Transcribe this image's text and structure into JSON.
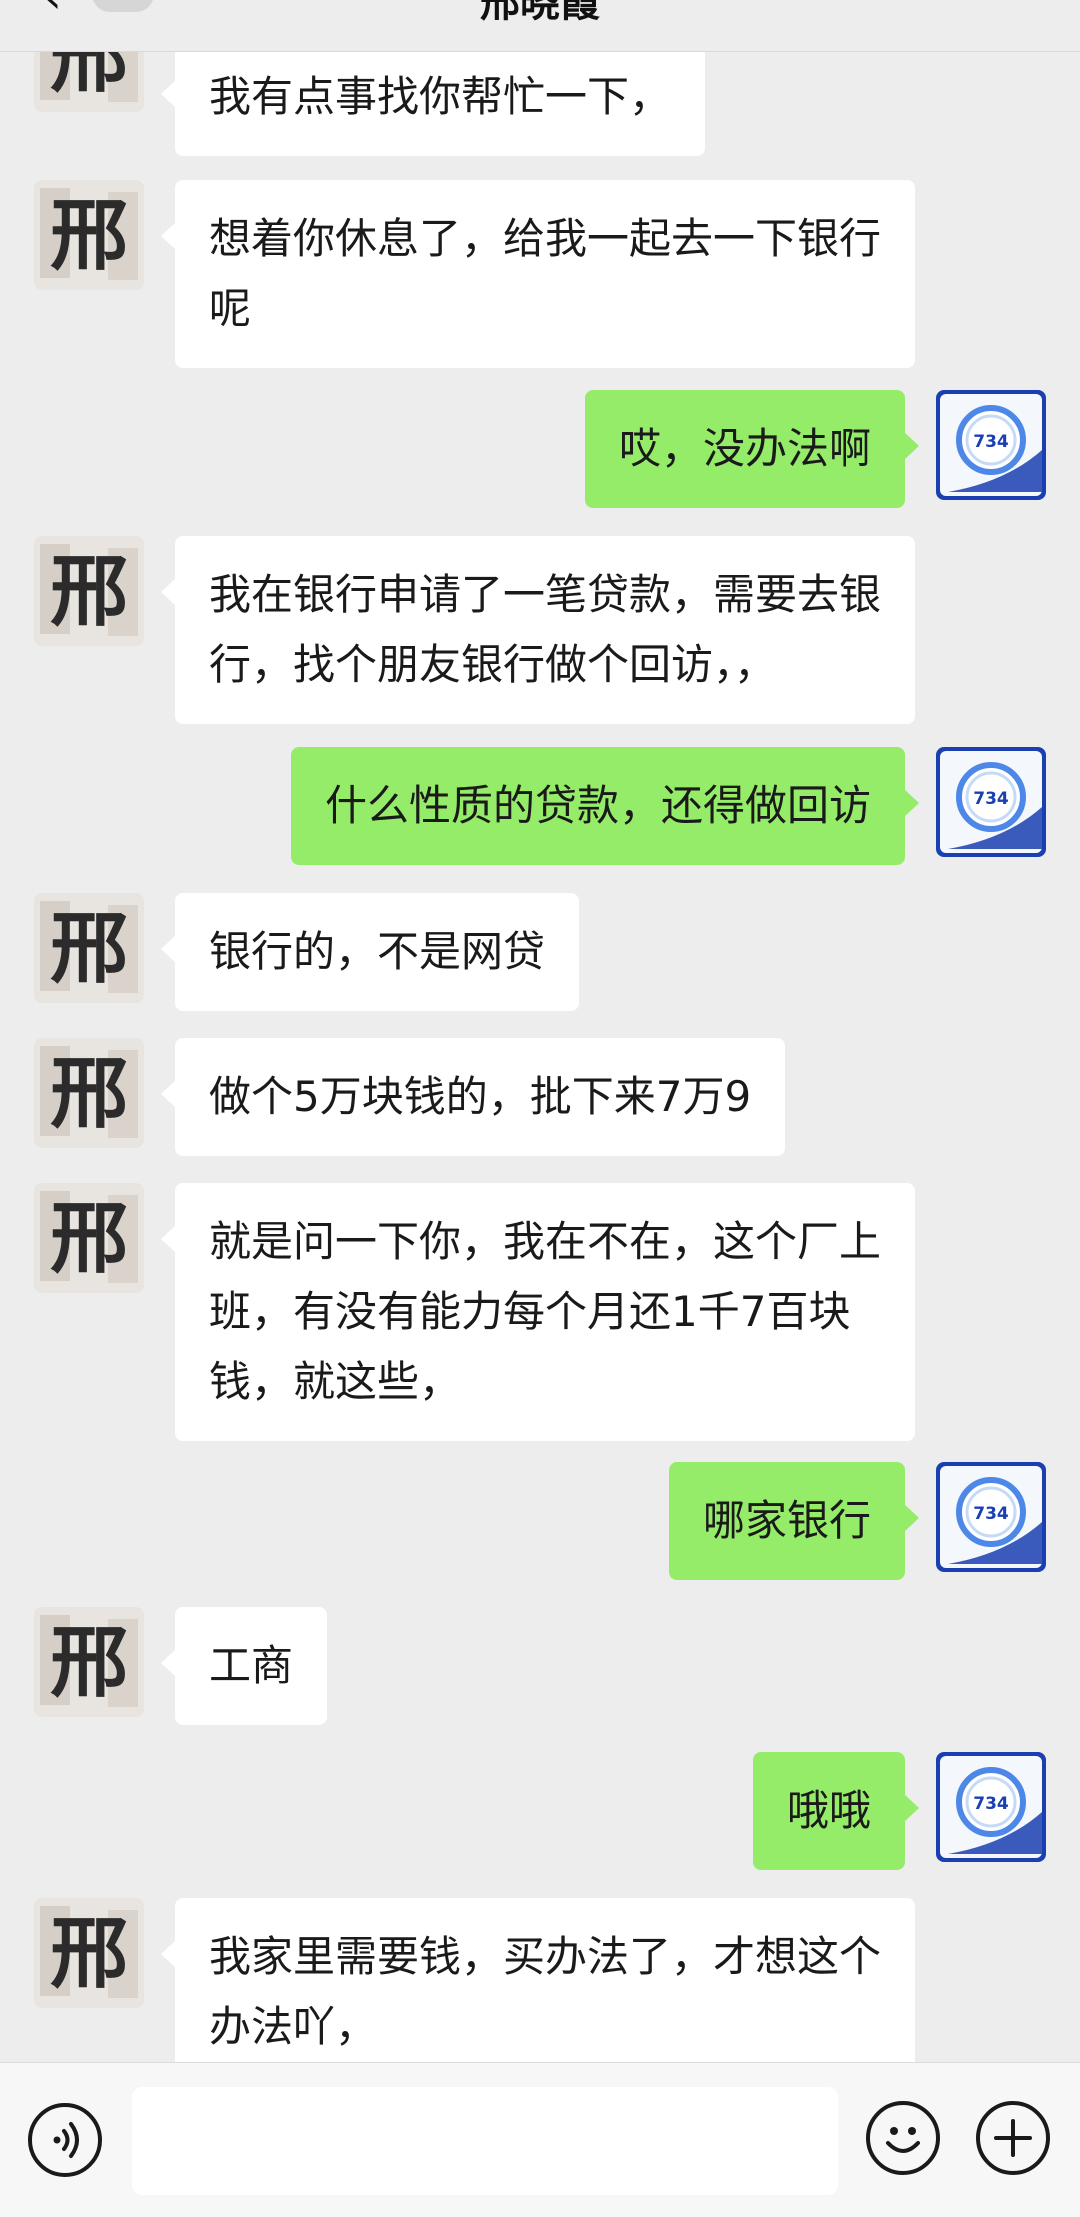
{
  "header": {
    "back_icon": "chevron-left-icon",
    "title": "邢晓霞"
  },
  "messages": [
    {
      "side": "in",
      "text": "我有点事找你帮忙一下，"
    },
    {
      "side": "in",
      "text": "想着你休息了，给我一起去一下银行\n呢"
    },
    {
      "side": "out",
      "text": "哎，没办法啊"
    },
    {
      "side": "in",
      "text": "我在银行申请了一笔贷款，需要去银\n行，找个朋友银行做个回访，，"
    },
    {
      "side": "out",
      "text": "什么性质的贷款，还得做回访"
    },
    {
      "side": "in",
      "text": "银行的，不是网贷"
    },
    {
      "side": "in",
      "text": "做个5万块钱的，批下来7万9"
    },
    {
      "side": "in",
      "text": "就是问一下你，我在不在，这个厂上\n班，有没有能力每个月还1千7百块\n钱，就这些，"
    },
    {
      "side": "out",
      "text": "哪家银行"
    },
    {
      "side": "in",
      "text": "工商"
    },
    {
      "side": "out",
      "text": "哦哦"
    },
    {
      "side": "in",
      "text": "我家里需要钱，买办法了，才想这个\n办法吖，"
    }
  ],
  "avatars": {
    "contact_character": "邢",
    "self_score": "734"
  },
  "input_bar": {
    "voice_icon": "voice-icon",
    "input_value": "",
    "emoji_icon": "emoji-icon",
    "plus_icon": "plus-icon"
  },
  "colors": {
    "background": "#ededed",
    "incoming_bubble": "#ffffff",
    "outgoing_bubble": "#95ec69",
    "self_avatar_bg": "#1a3fb0"
  }
}
